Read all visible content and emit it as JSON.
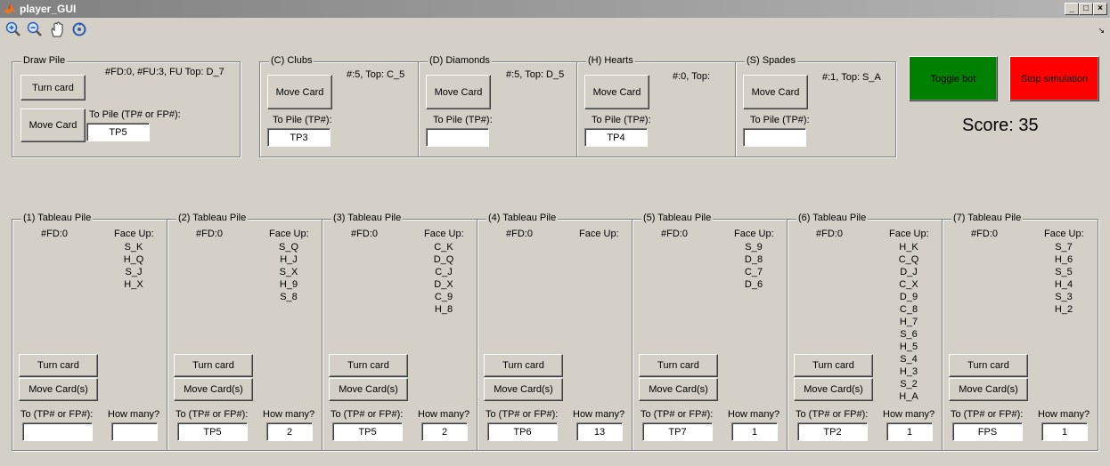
{
  "window": {
    "title": "player_GUI"
  },
  "toolbar": {
    "tools": [
      "zoom-in-icon",
      "zoom-out-icon",
      "pan-icon",
      "rotate-icon"
    ]
  },
  "draw_pile": {
    "legend": "Draw Pile",
    "status": "#FD:0, #FU:3, FU Top: D_7",
    "turn_label": "Turn card",
    "move_label": "Move Card",
    "to_pile_label": "To Pile (TP# or FP#):",
    "to_pile_value": "TP5"
  },
  "foundations": [
    {
      "legend": "(C) Clubs",
      "status": "#:5, Top: C_5",
      "move_label": "Move Card",
      "to_pile_label": "To Pile (TP#):",
      "to_pile_value": "TP3"
    },
    {
      "legend": "(D) Diamonds",
      "status": "#:5, Top: D_5",
      "move_label": "Move Card",
      "to_pile_label": "To Pile (TP#):",
      "to_pile_value": ""
    },
    {
      "legend": "(H) Hearts",
      "status": "#:0, Top:",
      "move_label": "Move Card",
      "to_pile_label": "To Pile (TP#):",
      "to_pile_value": "TP4"
    },
    {
      "legend": "(S) Spades",
      "status": "#:1, Top: S_A",
      "move_label": "Move Card",
      "to_pile_label": "To Pile (TP#):",
      "to_pile_value": ""
    }
  ],
  "controls": {
    "toggle_bot_label": "Toggle bot",
    "stop_label": "Stop simulation",
    "score": "Score: 35",
    "colors": {
      "toggle_bot": "#008000",
      "stop": "#ff0000"
    }
  },
  "tableau": [
    {
      "legend": "(1) Tableau Pile",
      "fd": "#FD:0",
      "faceup_label": "Face Up:",
      "cards": [
        "S_K",
        "H_Q",
        "S_J",
        "H_X"
      ],
      "turn_label": "Turn card",
      "move_label": "Move Card(s)",
      "to_label": "To (TP# or FP#):",
      "to_value": "",
      "howmany_label": "How many?",
      "howmany_value": ""
    },
    {
      "legend": "(2) Tableau Pile",
      "fd": "#FD:0",
      "faceup_label": "Face Up:",
      "cards": [
        "S_Q",
        "H_J",
        "S_X",
        "H_9",
        "S_8"
      ],
      "turn_label": "Turn card",
      "move_label": "Move Card(s)",
      "to_label": "To (TP# or FP#):",
      "to_value": "TP5",
      "howmany_label": "How many?",
      "howmany_value": "2"
    },
    {
      "legend": "(3) Tableau Pile",
      "fd": "#FD:0",
      "faceup_label": "Face Up:",
      "cards": [
        "C_K",
        "D_Q",
        "C_J",
        "D_X",
        "C_9",
        "H_8"
      ],
      "turn_label": "Turn card",
      "move_label": "Move Card(s)",
      "to_label": "To (TP# or FP#):",
      "to_value": "TP5",
      "howmany_label": "How many?",
      "howmany_value": "2"
    },
    {
      "legend": "(4) Tableau Pile",
      "fd": "#FD:0",
      "faceup_label": "Face Up:",
      "cards": [],
      "turn_label": "Turn card",
      "move_label": "Move Card(s)",
      "to_label": "To (TP# or FP#):",
      "to_value": "TP6",
      "howmany_label": "How many?",
      "howmany_value": "13"
    },
    {
      "legend": "(5) Tableau Pile",
      "fd": "#FD:0",
      "faceup_label": "Face Up:",
      "cards": [
        "S_9",
        "D_8",
        "C_7",
        "D_6"
      ],
      "turn_label": "Turn card",
      "move_label": "Move Card(s)",
      "to_label": "To (TP# or FP#):",
      "to_value": "TP7",
      "howmany_label": "How many?",
      "howmany_value": "1"
    },
    {
      "legend": "(6) Tableau Pile",
      "fd": "#FD:0",
      "faceup_label": "Face Up:",
      "cards": [
        "H_K",
        "C_Q",
        "D_J",
        "C_X",
        "D_9",
        "C_8",
        "H_7",
        "S_6",
        "H_5",
        "S_4",
        "H_3",
        "S_2",
        "H_A"
      ],
      "turn_label": "Turn card",
      "move_label": "Move Card(s)",
      "to_label": "To (TP# or FP#):",
      "to_value": "TP2",
      "howmany_label": "How many?",
      "howmany_value": "1"
    },
    {
      "legend": "(7) Tableau Pile",
      "fd": "#FD:0",
      "faceup_label": "Face Up:",
      "cards": [
        "S_7",
        "H_6",
        "S_5",
        "H_4",
        "S_3",
        "H_2"
      ],
      "turn_label": "Turn card",
      "move_label": "Move Card(s)",
      "to_label": "To (TP# or FP#):",
      "to_value": "FPS",
      "howmany_label": "How many?",
      "howmany_value": "1"
    }
  ]
}
